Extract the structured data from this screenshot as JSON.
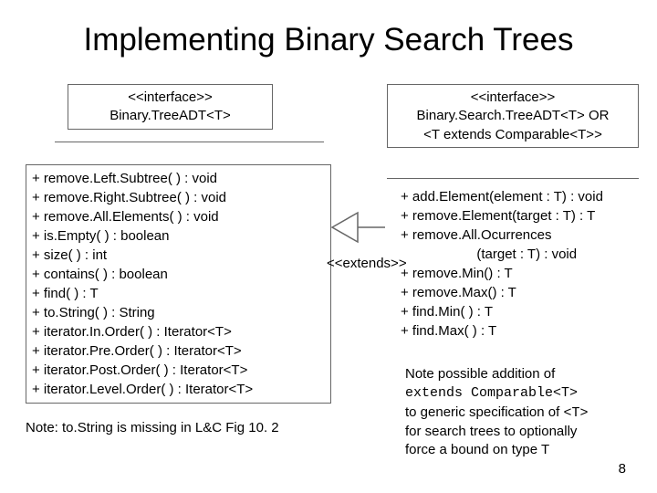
{
  "title": "Implementing Binary Search Trees",
  "left_interface": {
    "stereotype": "<<interface>>",
    "name": "Binary.TreeADT<T>",
    "methods": [
      "+ remove.Left.Subtree( ) : void",
      "+ remove.Right.Subtree( ) : void",
      "+ remove.All.Elements( ) : void",
      "+ is.Empty( ) : boolean",
      "+ size( ) : int",
      "+ contains( ) : boolean",
      "+ find( ) : T",
      "+ to.String( ) : String",
      "+ iterator.In.Order( ) : Iterator<T>",
      "+ iterator.Pre.Order( ) : Iterator<T>",
      "+ iterator.Post.Order( ) : Iterator<T>",
      "+ iterator.Level.Order( ) : Iterator<T>"
    ]
  },
  "right_interface": {
    "stereotype": "<<interface>>",
    "name_line1": "Binary.Search.TreeADT<T> OR",
    "name_line2": "<T extends Comparable<T>>",
    "methods": [
      "+ add.Element(element : T) : void",
      "+ remove.Element(target : T) : T",
      "+ remove.All.Ocurrences",
      "                    (target : T) : void",
      "+ remove.Min() : T",
      "+ remove.Max() : T",
      "+ find.Min( ) : T",
      "+ find.Max( ) : T"
    ]
  },
  "relationship": "<<extends>>",
  "note_left": "Note: to.String is missing in L&C Fig 10. 2",
  "note_right": {
    "l1": "Note possible addition of",
    "l2": "extends Comparable<T>",
    "l3a": "to generic specification of ",
    "l3b": "<T>",
    "l4": "for search trees to optionally",
    "l5": "force a bound on type T"
  },
  "page_number": "8"
}
